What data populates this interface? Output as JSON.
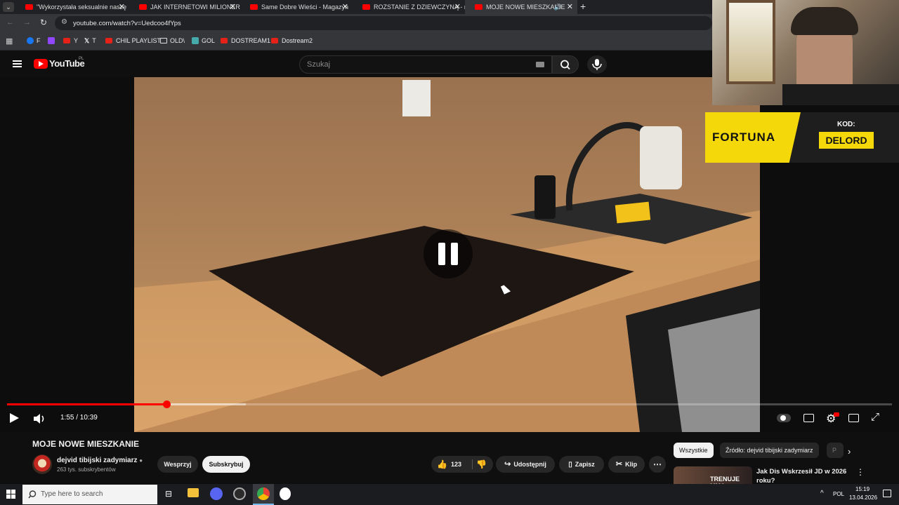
{
  "browser": {
    "tabs": [
      {
        "title": "\"Wykorzystała seksualnie naszę"
      },
      {
        "title": "JAK INTERNETOWI MILIONERZY"
      },
      {
        "title": "Same Dobre Wieści - Magazyn"
      },
      {
        "title": "ROZSTANIE Z DZIEWCZYNĄ - m"
      },
      {
        "title": "MOJE NOWE MIESZKANIE"
      }
    ],
    "url": "youtube.com/watch?v=Uedcoo4fYps",
    "bookmarks": [
      "F",
      "Y",
      "T",
      "CHIL PLAYLIST",
      "OLD\\",
      "GOL",
      "DOSTREAM1",
      "Dostream2"
    ]
  },
  "youtube": {
    "logo": "YouTube",
    "logo_region": "PL",
    "search_placeholder": "Szukaj"
  },
  "overlay": {
    "brand": "FORTUNA",
    "kod_label": "KOD:",
    "kod_value": "DELORD"
  },
  "player": {
    "time": "1:55 / 10:39",
    "progress": 0.18,
    "buffered": 0.27
  },
  "video": {
    "title": "MOJE NOWE MIESZKANIE",
    "channel": "dejvid tibijski zadymiarz",
    "subscribers": "263 tys. subskrybentów",
    "support_label": "Wesprzyj",
    "subscribe_label": "Subskrybuj",
    "likes": "123",
    "share_label": "Udostępnij",
    "save_label": "Zapisz",
    "clip_label": "Klip"
  },
  "sidebar": {
    "chips": [
      "Wszystkie",
      "Źródło: dejvid tibijski zadymiarz",
      "P"
    ],
    "rec_title": "Jak Dis Wskrzesił JD w 2026 roku?",
    "rec_thumb_text": "TRENUJE MMA"
  },
  "taskbar": {
    "search_placeholder": "Type here to search",
    "lang": "POL",
    "time": "15:19",
    "date": "13.04.2026"
  }
}
